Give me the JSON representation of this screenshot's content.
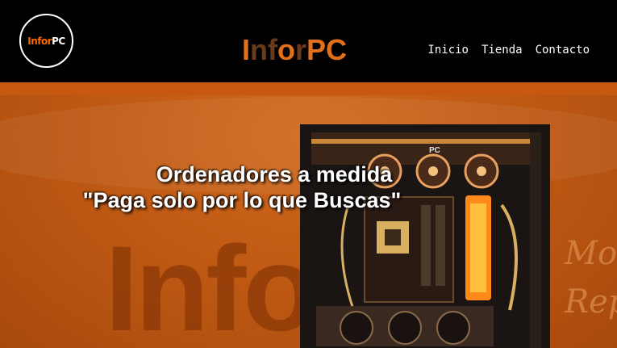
{
  "header": {
    "logo_text": "InforPC",
    "brand": {
      "p1": "I",
      "p2": "nf",
      "p3": "o",
      "p4": "r",
      "p5": "PC"
    },
    "nav": [
      "Inicio",
      "Tienda",
      "Contacto"
    ]
  },
  "hero": {
    "line1": "Ordenadores a medida",
    "line2": "\"Paga solo por lo que Buscas\"",
    "watermark": "Infor",
    "side_script1": "Mo",
    "side_script2": "Rep"
  },
  "colors": {
    "accent": "#e0701a",
    "hero_bg": "#c45f16",
    "header_bg": "#000000"
  }
}
